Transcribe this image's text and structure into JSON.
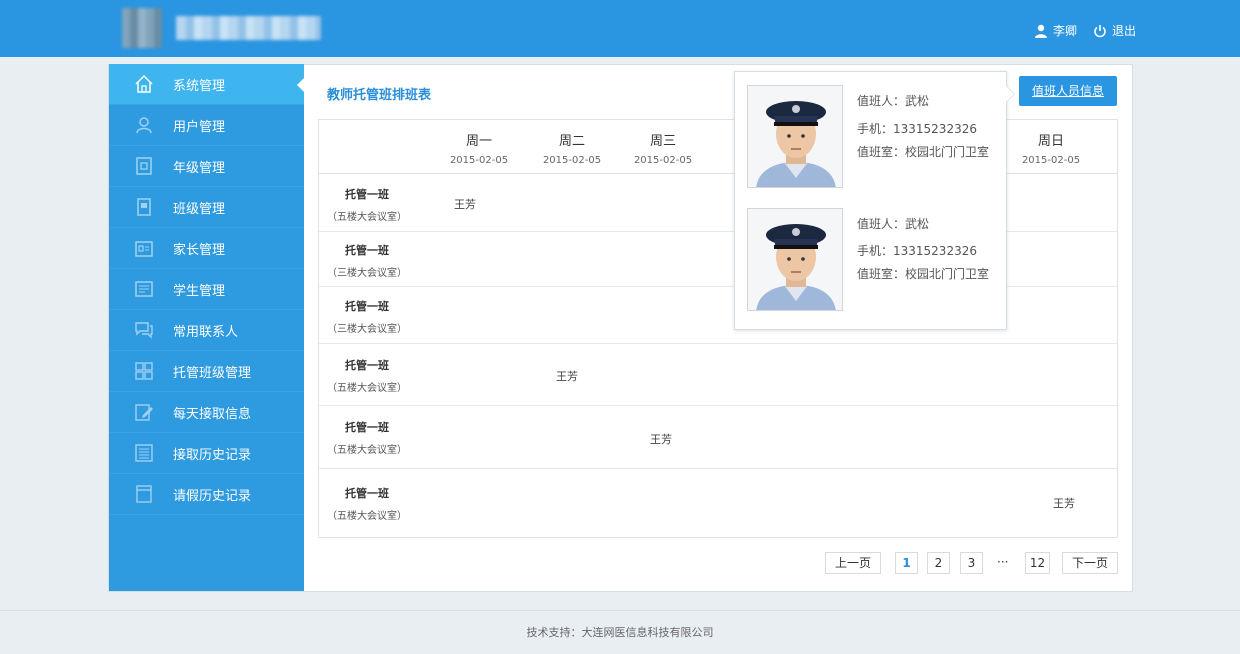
{
  "header": {
    "user_name": "李卿",
    "logout_label": "退出"
  },
  "sidebar": {
    "items": [
      {
        "label": "系统管理",
        "icon": "home-icon"
      },
      {
        "label": "用户管理",
        "icon": "user-icon"
      },
      {
        "label": "年级管理",
        "icon": "grade-icon"
      },
      {
        "label": "班级管理",
        "icon": "class-icon"
      },
      {
        "label": "家长管理",
        "icon": "parent-icon"
      },
      {
        "label": "学生管理",
        "icon": "student-icon"
      },
      {
        "label": "常用联系人",
        "icon": "chat-icon"
      },
      {
        "label": "托管班级管理",
        "icon": "grid-icon"
      },
      {
        "label": "每天接取信息",
        "icon": "edit-icon"
      },
      {
        "label": "接取历史记录",
        "icon": "list-icon"
      },
      {
        "label": "请假历史记录",
        "icon": "doc-icon"
      }
    ]
  },
  "main": {
    "title": "教师托管班排班表",
    "info_button": "值班人员信息",
    "days": [
      {
        "label": "周一",
        "date": "2015-02-05"
      },
      {
        "label": "周二",
        "date": "2015-02-05"
      },
      {
        "label": "周三",
        "date": "2015-02-05"
      },
      {
        "label": "周日",
        "date": "2015-02-05"
      }
    ],
    "rows": [
      {
        "name": "托管一班",
        "room": "（五楼大会议室）",
        "teacher": "王芳"
      },
      {
        "name": "托管一班",
        "room": "（三楼大会议室）",
        "teacher": ""
      },
      {
        "name": "托管一班",
        "room": "（三楼大会议室）",
        "teacher": ""
      },
      {
        "name": "托管一班",
        "room": "（五楼大会议室）",
        "teacher": "王芳"
      },
      {
        "name": "托管一班",
        "room": "（五楼大会议室）",
        "teacher": "王芳"
      },
      {
        "name": "托管一班",
        "room": "（五楼大会议室）",
        "teacher": "王芳"
      }
    ]
  },
  "popover": {
    "persons": [
      {
        "duty": "值班人：武松",
        "phone": "手机：13315232326",
        "room": "值班室：校园北门门卫室"
      },
      {
        "duty": "值班人：武松",
        "phone": "手机：13315232326",
        "room": "值班室：校园北门门卫室"
      }
    ]
  },
  "pagination": {
    "prev": "上一页",
    "pages": [
      "1",
      "2",
      "3"
    ],
    "ellipsis": "···",
    "last": "12",
    "next": "下一页",
    "current": "1"
  },
  "footer": {
    "text": "技术支持：大连网医信息科技有限公司"
  },
  "colors": {
    "header_bg": "#2a95e0",
    "sidebar_bg": "#2e9ae0",
    "sidebar_active": "#3fb5f0",
    "accent": "#2a8fd8"
  }
}
